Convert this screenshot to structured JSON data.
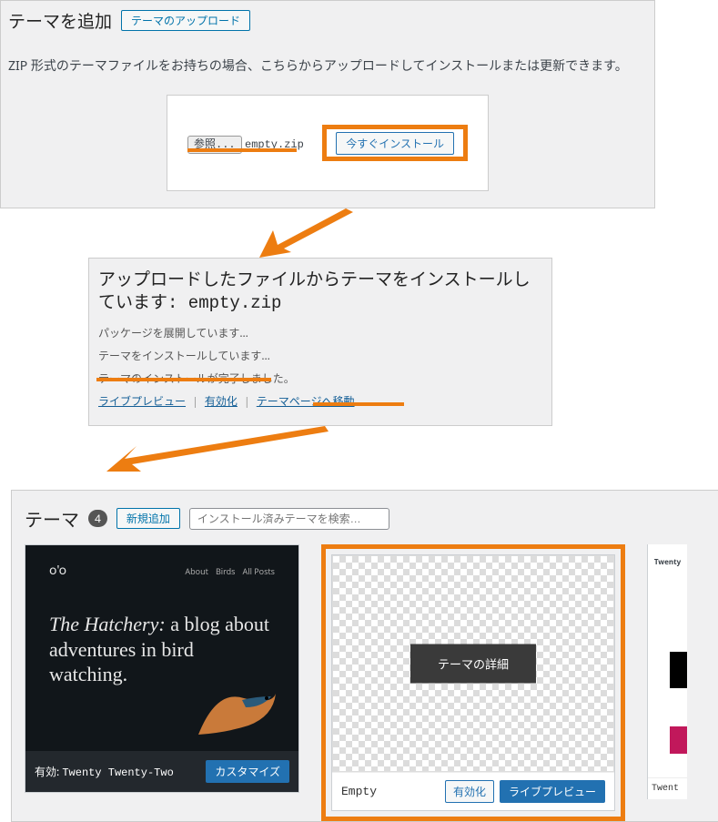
{
  "panel1": {
    "title": "テーマを追加",
    "upload_btn": "テーマのアップロード",
    "note": "ZIP 形式のテーマファイルをお持ちの場合、こちらからアップロードしてインストールまたは更新できます。",
    "browse": "参照...",
    "filename": "empty.zip",
    "install": "今すぐインストール"
  },
  "panel2": {
    "title": "アップロードしたファイルからテーマをインストールしています: empty.zip",
    "line1": "パッケージを展開しています…",
    "line2": "テーマをインストールしています…",
    "line3": "テーマのインストールが完了しました。",
    "link_preview": "ライブプレビュー",
    "link_activate": "有効化",
    "link_goto": "テーマページへ移動"
  },
  "panel3": {
    "title": "テーマ",
    "count": "4",
    "add_new": "新規追加",
    "search_placeholder": "インストール済みテーマを検索…",
    "card1": {
      "nav": [
        "About",
        "Birds",
        "All Posts"
      ],
      "headline_em": "The Hatchery:",
      "headline_rest": " a blog about adventures in bird watching.",
      "active_label": "有効:",
      "name": "Twenty Twenty-Two",
      "customize": "カスタマイズ"
    },
    "card2": {
      "details": "テーマの詳細",
      "name": "Empty",
      "activate": "有効化",
      "preview": "ライブプレビュー"
    },
    "card3": {
      "top": "Twenty",
      "foot": "Twent"
    }
  }
}
